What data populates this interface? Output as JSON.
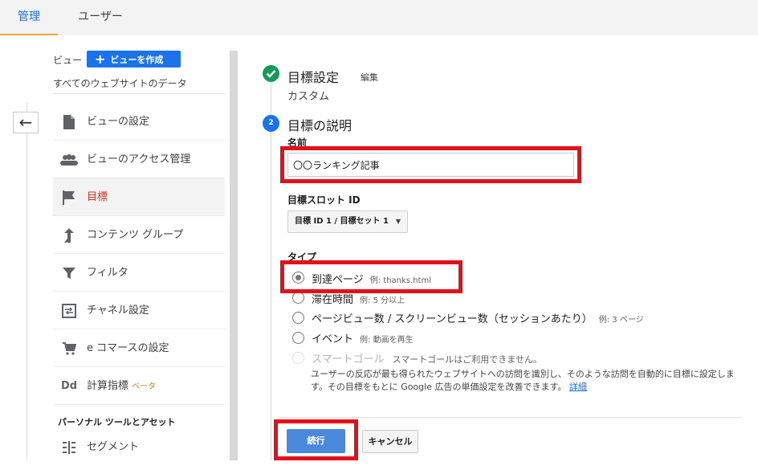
{
  "tabs": {
    "admin": "管理",
    "user": "ユーザー"
  },
  "sidebar": {
    "view_label": "ビュー",
    "create_view": "ビューを作成",
    "all_sites": "すべてのウェブサイトのデータ",
    "items": [
      {
        "label": "ビューの設定",
        "icon": "document-icon"
      },
      {
        "label": "ビューのアクセス管理",
        "icon": "people-icon"
      },
      {
        "label": "目標",
        "icon": "flag-icon"
      },
      {
        "label": "コンテンツ グループ",
        "icon": "content-group-icon"
      },
      {
        "label": "フィルタ",
        "icon": "filter-icon"
      },
      {
        "label": "チャネル設定",
        "icon": "channel-icon"
      },
      {
        "label": "e コマースの設定",
        "icon": "cart-icon"
      },
      {
        "label": "計算指標",
        "icon": "dd-icon",
        "badge": "ベータ"
      }
    ],
    "section_title": "パーソナル ツールとアセット",
    "segment": "セグメント"
  },
  "goal": {
    "step1_title": "目標設定",
    "edit": "編集",
    "step1_subtitle": "カスタム",
    "step2_number": "2",
    "step2_title": "目標の説明",
    "name_label": "名前",
    "name_value": "〇〇ランキング記事",
    "slot_label": "目標スロット ID",
    "slot_value": "目標 ID 1 / 目標セット 1",
    "type_label": "タイプ",
    "types": [
      {
        "label": "到達ページ",
        "example": "例: thanks.html",
        "checked": true
      },
      {
        "label": "滞在時間",
        "example": "例: 5 分以上"
      },
      {
        "label": "ページビュー数 / スクリーンビュー数（セッションあたり）",
        "example": "例: 3 ページ"
      },
      {
        "label": "イベント",
        "example": "例: 動画を再生"
      },
      {
        "label": "スマートゴール",
        "example": "スマートゴールはご利用できません。",
        "disabled": true
      }
    ],
    "smart_desc": "ユーザーの反応が最も得られたウェブサイトへの訪問を識別し、そのような訪問を自動的に目標に設定します。その目標をもとに Google 広告の単価設定を改善できます。",
    "details_link": "詳細",
    "continue": "続行",
    "cancel": "キャンセル"
  },
  "colors": {
    "accent": "#1a73e8",
    "highlight": "#e3101b",
    "success": "#0f9d58",
    "active_tab_underline": "#f4a533"
  }
}
